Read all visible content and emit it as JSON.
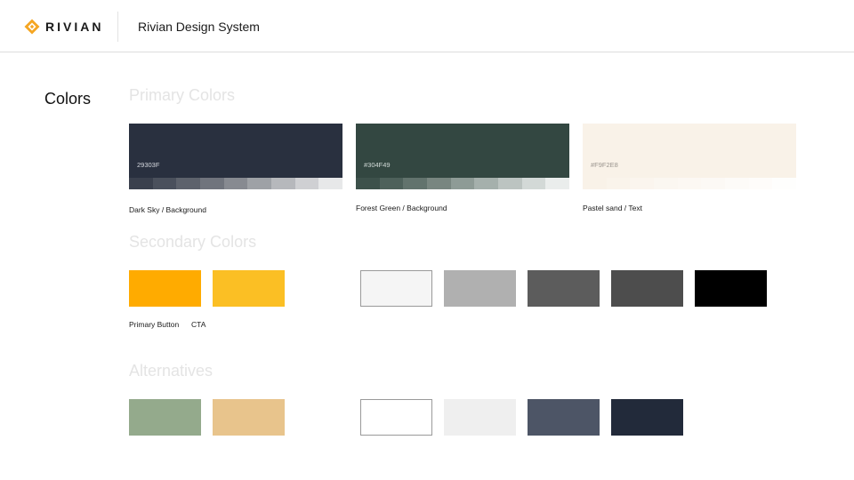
{
  "header": {
    "brand": "RIVIAN",
    "title": "Rivian Design System",
    "brand_color": "#f5a623"
  },
  "section": {
    "title": "Colors"
  },
  "primary": {
    "heading": "Primary Colors",
    "cards": [
      {
        "hex_label": "29303F",
        "color": "#29303f",
        "text_color": "#d7dae0",
        "caption": "Dark Sky / Background",
        "tints": [
          "#3a404d",
          "#4a505c",
          "#5d626c",
          "#70747d",
          "#878a91",
          "#9ea1a6",
          "#b6b8bc",
          "#cfd0d3",
          "#e7e8e9"
        ]
      },
      {
        "hex_label": "#304F49",
        "color": "#334741",
        "text_color": "#d2dbd8",
        "caption": "Forest Green / Background",
        "tints": [
          "#3d514b",
          "#4e615b",
          "#62736d",
          "#788680",
          "#8e9b96",
          "#a5b0ac",
          "#bcc4c1",
          "#d3d9d7",
          "#eaedec"
        ]
      },
      {
        "hex_label": "#F9F2E8",
        "color": "#f9f2e8",
        "text_color": "#9a958e",
        "caption": "Pastel sand / Text",
        "tints": [
          "#f9f2e8",
          "#faf4eb",
          "#fbf5ee",
          "#fbf7f1",
          "#fcf8f3",
          "#fcf9f5",
          "#fdfbf8",
          "#fefcfa",
          "#fefefd"
        ]
      }
    ]
  },
  "secondary": {
    "heading": "Secondary Colors",
    "accents": [
      {
        "color": "#ffab00",
        "label": "Primary Button"
      },
      {
        "color": "#fbbf24",
        "label": "CTA"
      }
    ],
    "neutrals": [
      {
        "color": "#f5f5f5",
        "outlined": true
      },
      {
        "color": "#b0b0b0",
        "outlined": false
      },
      {
        "color": "#5c5c5c",
        "outlined": false
      },
      {
        "color": "#4d4d4d",
        "outlined": false
      },
      {
        "color": "#000000",
        "outlined": false
      }
    ]
  },
  "alternatives": {
    "heading": "Alternatives",
    "accents": [
      {
        "color": "#94aa8c"
      },
      {
        "color": "#e8c48c"
      }
    ],
    "neutrals": [
      {
        "color": "#ffffff",
        "outlined": true
      },
      {
        "color": "#efefef",
        "outlined": false
      },
      {
        "color": "#4d5566",
        "outlined": false
      },
      {
        "color": "#222a3a",
        "outlined": false
      }
    ]
  }
}
